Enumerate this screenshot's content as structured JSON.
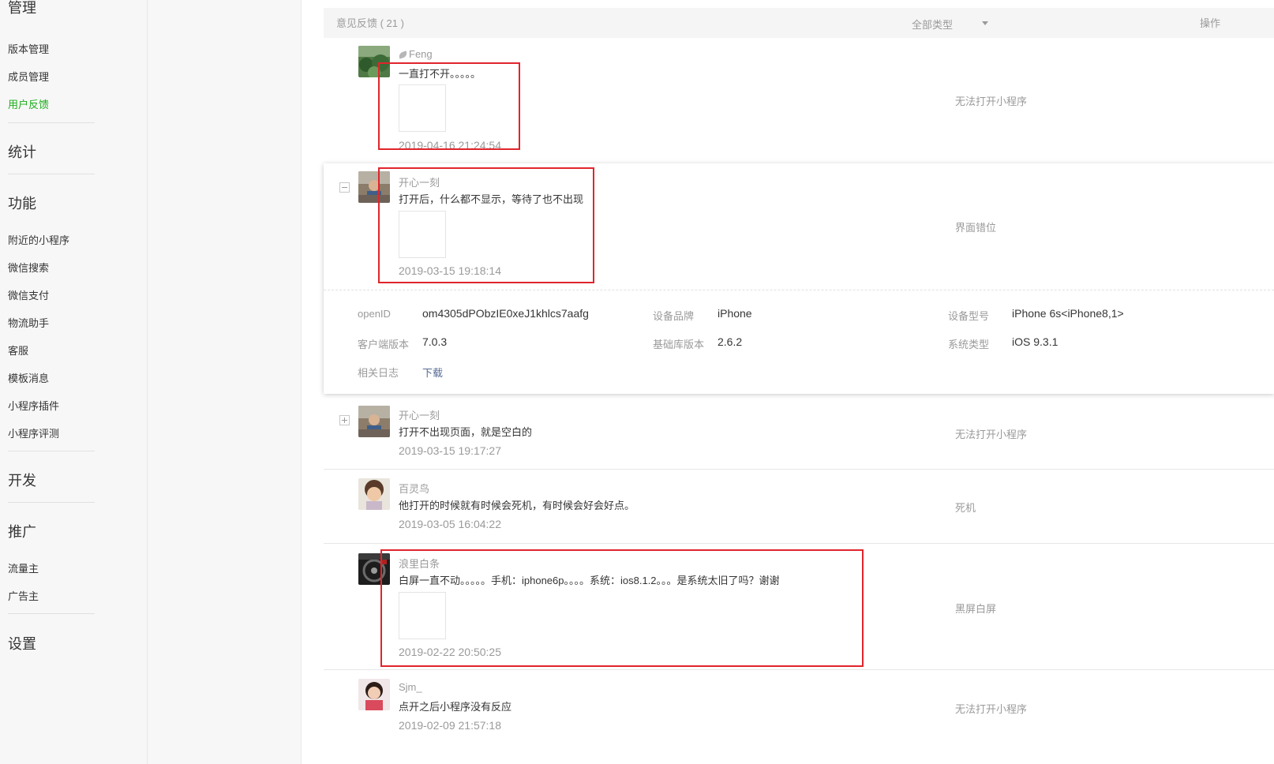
{
  "sidebar": {
    "manage_heading": "管理",
    "items_manage": [
      "版本管理",
      "成员管理",
      "用户反馈"
    ],
    "stats_heading": "统计",
    "func_heading": "功能",
    "items_func": [
      "附近的小程序",
      "微信搜索",
      "微信支付",
      "物流助手",
      "客服",
      "模板消息",
      "小程序插件",
      "小程序评测"
    ],
    "dev_heading": "开发",
    "promo_heading": "推广",
    "items_promo": [
      "流量主",
      "广告主"
    ],
    "settings_heading": "设置"
  },
  "table": {
    "title": "意见反馈 ( 21 )",
    "type_filter": "全部类型",
    "action_col": "操作"
  },
  "feedback": [
    {
      "name": "Feng",
      "content": "一直打不开。。。。。",
      "time": "2019-04-16 21:24:54",
      "type": "无法打开小程序"
    },
    {
      "name": "开心一刻",
      "content": "打开后，什么都不显示，等待了也不出现",
      "time": "2019-03-15 19:18:14",
      "type": "界面错位"
    },
    {
      "name": "开心一刻",
      "content": "打开不出现页面，就是空白的",
      "time": "2019-03-15 19:17:27",
      "type": "无法打开小程序"
    },
    {
      "name": "百灵鸟",
      "content": "他打开的时候就有时候会死机，有时候会好会好点。",
      "time": "2019-03-05 16:04:22",
      "type": "死机"
    },
    {
      "name": "浪里白条",
      "content": "白屏一直不动。。。。。手机：iphone6p。。。。系统：ios8.1.2。。。是系统太旧了吗？谢谢",
      "time": "2019-02-22 20:50:25",
      "type": "黑屏白屏"
    },
    {
      "name": "Sjm_",
      "content": "点开之后小程序没有反应",
      "time": "2019-02-09 21:57:18",
      "type": "无法打开小程序"
    }
  ],
  "details": {
    "openid_label": "openID",
    "openid_value": "om4305dPObzIE0xeJ1khlcs7aafg",
    "brand_label": "设备品牌",
    "brand_value": "iPhone",
    "model_label": "设备型号",
    "model_value": "iPhone 6s<iPhone8,1>",
    "client_label": "客户端版本",
    "client_value": "7.0.3",
    "lib_label": "基础库版本",
    "lib_value": "2.6.2",
    "os_label": "系统类型",
    "os_value": "iOS 9.3.1",
    "log_label": "相关日志",
    "log_link": "下载"
  },
  "colors": {
    "accent_green": "#1aad19",
    "highlight_red": "#e0252c",
    "link_blue": "#576b95"
  }
}
